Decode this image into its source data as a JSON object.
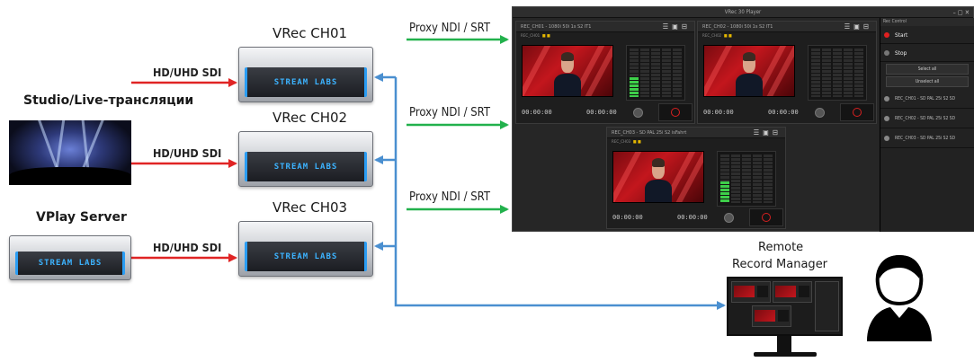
{
  "sources": {
    "studio_label": "Studio/Live-трансляции",
    "vplay_label": "VPlay Server"
  },
  "servers": [
    {
      "label": "VRec CH01",
      "brand": "STREAM LABS"
    },
    {
      "label": "VRec CH02",
      "brand": "STREAM LABS"
    },
    {
      "label": "VRec CH03",
      "brand": "STREAM LABS"
    }
  ],
  "vplay_brand": "STREAM LABS",
  "links": {
    "sdi": [
      "HD/UHD SDI",
      "HD/UHD SDI",
      "HD/UHD SDI"
    ],
    "proxy": [
      "Proxy NDI / SRT",
      "Proxy NDI / SRT",
      "Proxy NDI / SRT"
    ]
  },
  "app": {
    "title": "VRec 30 Player",
    "panel_titles": [
      "REC_CH01 - 1080i 50i 1s S2 IT1",
      "REC_CH02 - 1080i 50i 1s S2 IT1",
      "REC_CH03 - SD PAL 25i S2 isFahrt"
    ],
    "timecodes": [
      "00:00:00",
      "00:00:00",
      "00:00:00",
      "00:00:00",
      "00:00:00",
      "00:00:00"
    ],
    "sidebar": {
      "header": "Rec Control",
      "start_label": "Start",
      "stop_label": "Stop",
      "select_all": "Select all",
      "unselect_all": "Unselect all",
      "channels": [
        "REC_CH01 - SD PAL 25i S2 SD",
        "REC_CH02 - SD PAL 25i S2 SD",
        "REC_CH03 - SD PAL 25i S2 SD"
      ]
    },
    "colors": {
      "record": "#d62020",
      "meter": "#3ecf4a",
      "start_dot": "#e02020"
    }
  },
  "remote": {
    "line1": "Remote",
    "line2": "Record Manager"
  },
  "colors": {
    "sdi_arrow": "#e02424",
    "proxy_arrow": "#22b14c",
    "return_arrow": "#4a8fd0"
  }
}
